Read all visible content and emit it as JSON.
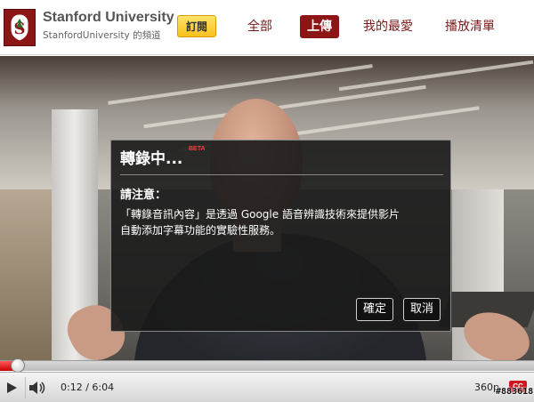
{
  "colors": {
    "brand": "#8c1515",
    "subscribe": "#f7c21a",
    "progress": "#c80000",
    "beta": "#ff3b3b"
  },
  "channel": {
    "logo_icon": "stanford-tree-icon",
    "name": "Stanford University",
    "subtitle": "StanfordUniversity 的頻道",
    "subscribe_label": "訂閱"
  },
  "nav": {
    "tabs": [
      {
        "label": "全部",
        "active": false
      },
      {
        "label": "上傳",
        "active": true
      },
      {
        "label": "我的最愛",
        "active": false
      },
      {
        "label": "播放清單",
        "active": false
      }
    ]
  },
  "dialog": {
    "title": "轉錄中...",
    "beta": "BETA",
    "note": "請注意：",
    "line1": "「轉錄音訊內容」是透過 Google 語音辨識技術來提供影片",
    "line2": "自動添加字幕功能的實驗性服務。",
    "ok_label": "確定",
    "cancel_label": "取消"
  },
  "player": {
    "current_time": "0:12",
    "duration": "6:04",
    "time_text": "0:12 / 6:04",
    "progress_fraction": 0.033,
    "buffer_fraction": 0.0,
    "quality": "360p",
    "cc_label": "CC",
    "play_icon": "play-icon",
    "volume_icon": "volume-icon"
  },
  "watermark": "#883618"
}
